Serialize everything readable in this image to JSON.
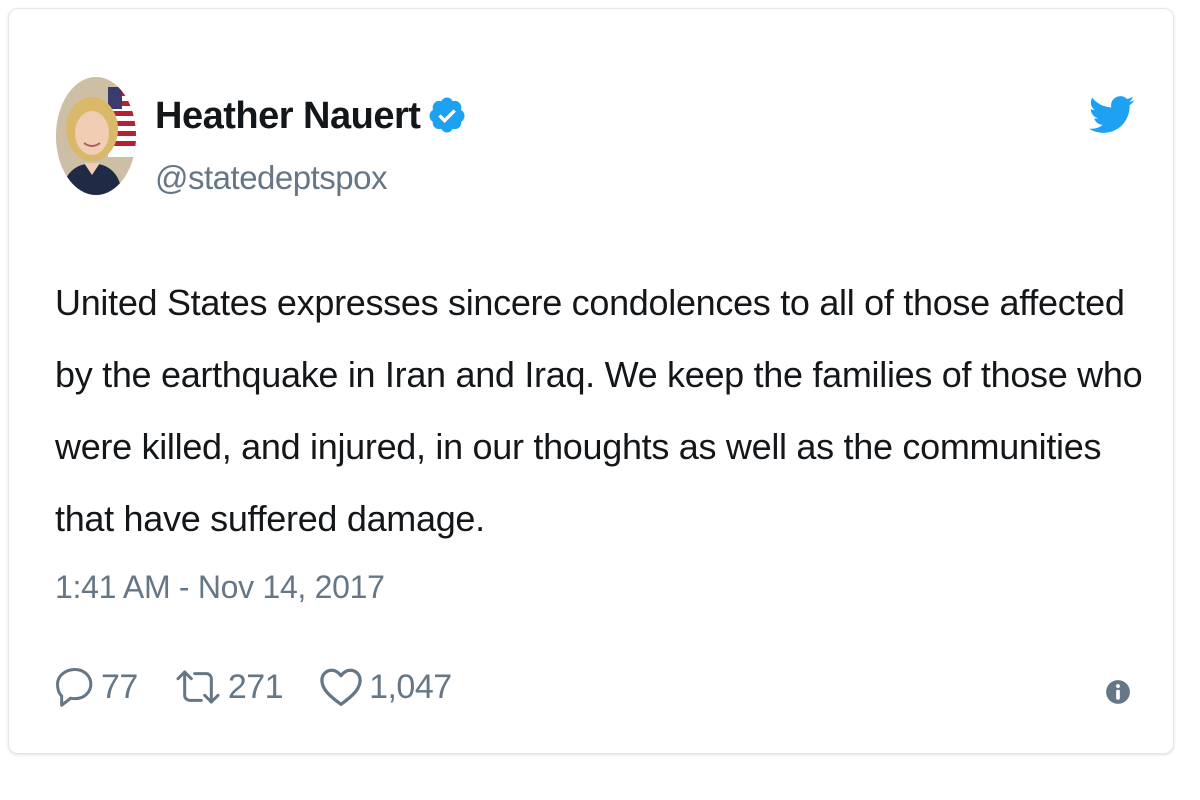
{
  "author": {
    "name": "Heather Nauert",
    "handle": "@statedeptspox",
    "verified": true
  },
  "tweet": {
    "text": "United States expresses sincere condolences to all of those affected by the earthquake in Iran and Iraq. We keep the families of those who were killed, and injured, in our thoughts as well as the communities that have suffered damage.",
    "timestamp": "1:41 AM - Nov 14, 2017"
  },
  "stats": {
    "replies": "77",
    "retweets": "271",
    "likes": "1,047"
  },
  "icons": {
    "brand": "twitter-bird-icon",
    "verified": "verified-badge-icon",
    "reply": "reply-icon",
    "retweet": "retweet-icon",
    "like": "heart-icon",
    "info": "info-icon"
  },
  "colors": {
    "brand_blue": "#1da1f2",
    "text": "#14171a",
    "muted": "#657786",
    "border": "#e1e8ed"
  }
}
